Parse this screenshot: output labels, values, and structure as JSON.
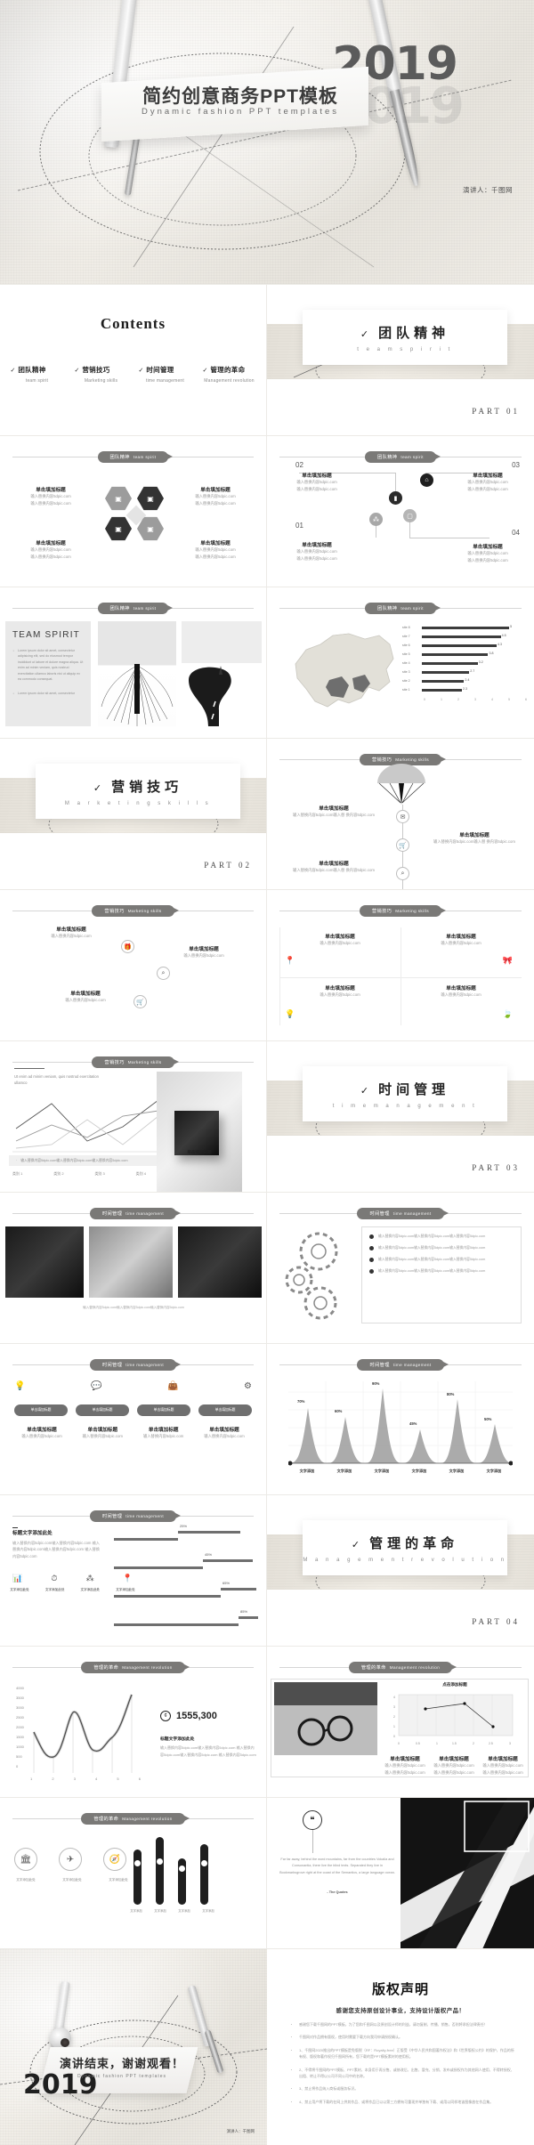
{
  "cover": {
    "year": "2019",
    "ghost": "2019",
    "title": "简约创意商务PPT模板",
    "subtitle": "Dynamic  fashion  PPT  templates",
    "speaker": "演讲人：千图网"
  },
  "contents": {
    "title": "Contents",
    "items": [
      {
        "tick": "✓",
        "cn": "团队精神",
        "en": "team spirit"
      },
      {
        "tick": "✓",
        "cn": "营销技巧",
        "en": "Marketing skills"
      },
      {
        "tick": "✓",
        "cn": "时间管理",
        "en": "time management"
      },
      {
        "tick": "✓",
        "cn": "管理的革命",
        "en": "Management revolution"
      }
    ]
  },
  "sections": [
    {
      "tick": "✓",
      "cn": "团队精神",
      "en": "t e a m   s p i r i t",
      "part": "PART  01"
    },
    {
      "tick": "✓",
      "cn": "营销技巧",
      "en": "M a r k e t i n g   s k i l l s",
      "part": "PART  02"
    },
    {
      "tick": "✓",
      "cn": "时间管理",
      "en": "t i m e   m a n a g e m e n t",
      "part": "PART  03"
    },
    {
      "tick": "✓",
      "cn": "管理的革命",
      "en": "M a n a g e m e n t   r e v o l u t i o n",
      "part": "PART  04"
    }
  ],
  "badges": {
    "team": {
      "cn": "团队精神",
      "en": "team spirit"
    },
    "mkt": {
      "cn": "营销技巧",
      "en": "Marketing skills"
    },
    "time": {
      "cn": "时间管理",
      "en": "time management"
    },
    "mgmt": {
      "cn": "管理的革命",
      "en": "Management revolution"
    }
  },
  "placeholder": {
    "title": "单击填加标题",
    "body1": "输入替换内容5dpic.com",
    "body2": "输入替换内容5dpic.com",
    "body_long": "输入替换内容5dpic.com输入替换内容5dpic.com",
    "title_here": "标题文字添加此处",
    "click_add": "点击添加标题",
    "text_add": "文字添加",
    "text_add2": "文字添加此处"
  },
  "slide_hex": {
    "blocks": [
      {
        "title": "单击填加标题",
        "b1": "输入替换内容5dpic.com",
        "b2": "输入替换内容5dpic.com"
      },
      {
        "title": "单击填加标题",
        "b1": "输入替换内容5dpic.com",
        "b2": "输入替换内容5dpic.com"
      },
      {
        "title": "单击填加标题",
        "b1": "输入替换内容5dpic.com",
        "b2": "输入替换内容5dpic.com"
      },
      {
        "title": "单击填加标题",
        "b1": "输入替换内容5dpic.com",
        "b2": "输入替换内容5dpic.com"
      }
    ]
  },
  "slide_timeline": {
    "nums": [
      "01",
      "02",
      "03",
      "04"
    ],
    "blocks": [
      {
        "title": "单击填加标题",
        "b1": "输入替换内容5dpic.com",
        "b2": "输入替换内容5dpic.com"
      },
      {
        "title": "单击填加标题",
        "b1": "输入替换内容5dpic.com",
        "b2": "输入替换内容5dpic.com"
      },
      {
        "title": "单击填加标题",
        "b1": "输入替换内容5dpic.com",
        "b2": "输入替换内容5dpic.com"
      },
      {
        "title": "单击填加标题",
        "b1": "输入替换内容5dpic.com",
        "b2": "输入替换内容5dpic.com"
      }
    ]
  },
  "team_spirit_panel": {
    "heading": "TEAM  SPIRIT",
    "items": [
      "Lorem ipsum dolor sit amet, consectetur adipisicing elit, sed do eiusmod tempor incididunt ut labore et dolore magna aliqua. Ut enim ad minim veniam, quis nostrud exercitation ullamco laboris nisi ut aliquip ex ea commodo consequat.",
      "Lorem ipsum dolor sit amet, consectetur"
    ]
  },
  "chart_data": [
    {
      "type": "bar",
      "title": "",
      "orientation": "horizontal",
      "categories": [
        "site 1",
        "site 2",
        "site 3",
        "site 4",
        "site 5",
        "site 6",
        "site 7",
        "site 8"
      ],
      "values": [
        2.3,
        2.4,
        2.7,
        3.2,
        3.8,
        4.3,
        4.5,
        5.0
      ],
      "xlabel": "",
      "ylabel": "",
      "xlim": [
        0,
        6
      ],
      "xticks": [
        "0",
        "1",
        "2",
        "3",
        "4",
        "5",
        "6"
      ],
      "grid": false,
      "legend": "none"
    },
    {
      "type": "area",
      "title": "",
      "categories": [
        "文字添加",
        "文字添加",
        "文字添加",
        "文字添加",
        "文字添加",
        "文字添加"
      ],
      "values": [
        70,
        60,
        90,
        45,
        80,
        50
      ],
      "labels": [
        "70%",
        "60%",
        "90%",
        "45%",
        "80%",
        "50%"
      ],
      "ylim": [
        0,
        100
      ],
      "grid": true,
      "legend": "none"
    },
    {
      "type": "line",
      "title": "",
      "x": [
        "1",
        "2",
        "3",
        "4",
        "5",
        "6"
      ],
      "values": [
        1950,
        900,
        2780,
        1100,
        1750,
        3500
      ],
      "ylim": [
        0,
        4000
      ],
      "yticks": [
        "0",
        "500",
        "1000",
        "1500",
        "2000",
        "2500",
        "3000",
        "3500",
        "4000"
      ],
      "callout_value": "1555,300",
      "callout_title": "标题文字添加此处",
      "callout_body": "输入替换内容5dpic.com输入替换内容5dpic.com 输入替换内容5dpic.com输入替换内容5dpic.com 输入替换内容5dpic.com",
      "grid": false,
      "legend": "none"
    },
    {
      "type": "line",
      "title": "点击添加标题",
      "x": [
        0.7,
        1.8,
        2.6
      ],
      "values": [
        2.6,
        3.1,
        0.9
      ],
      "xlim": [
        0,
        3
      ],
      "ylim": [
        0,
        4
      ],
      "xticks": [
        "0",
        "0.5",
        "1",
        "1.5",
        "2",
        "2.5",
        "3"
      ],
      "yticks": [
        "0",
        "1",
        "2",
        "3",
        "4"
      ],
      "grid": true,
      "legend": "none"
    },
    {
      "type": "bar",
      "title": "标题文字添加此处",
      "orientation": "horizontal",
      "categories": [
        "文字添加此处",
        "文字添加此处",
        "文字添加此处",
        "文字添加此处"
      ],
      "values": [
        25,
        45,
        65,
        85
      ],
      "labels": [
        "25%",
        "45%",
        "65%",
        "85%"
      ],
      "xlim": [
        0,
        100
      ],
      "grid": false,
      "legend": "none"
    }
  ],
  "slide_mkt_icons": {
    "blocks": [
      {
        "title": "单击填加标题",
        "body": "输入替换内容5dpic.com输入替 换内容5dpic.com"
      },
      {
        "title": "单击填加标题",
        "body": "输入替换内容5dpic.com输入替 换内容5dpic.com"
      },
      {
        "title": "单击填加标题",
        "body": "输入替换内容5dpic.com输入替 换内容5dpic.com"
      },
      {
        "title": "单击填加标题",
        "body": "输入替换内容5dpic.com输入替 换内容5dpic.com"
      }
    ]
  },
  "slide_mkt_grid": {
    "blocks": [
      {
        "title": "单击填加标题",
        "body": "输入替换内容5dpic.com"
      },
      {
        "title": "单击填加标题",
        "body": "输入替换内容5dpic.com"
      },
      {
        "title": "单击填加标题",
        "body": "输入替换内容5dpic.com"
      },
      {
        "title": "单击填加标题",
        "body": "输入替换内容5dpic.com"
      }
    ]
  },
  "slide_mkt_lines": {
    "lead": "Ut enim ad minim veniam, quis nostrud exercitation ullamco",
    "legend": "输入替换内容5dpic.com输入替换内容5dpic.com输入替换内容5dpic.com",
    "axis": [
      "类别 1",
      "类别 2",
      "类别 3",
      "类别 4"
    ],
    "caption": "单击填加标题"
  },
  "slide_gears": {
    "rows": [
      "输入替换内容5dpic.com输入替换内容5dpic.com输入替换内容5dpic.com",
      "输入替换内容5dpic.com输入替换内容5dpic.com输入替换内容5dpic.com",
      "输入替换内容5dpic.com输入替换内容5dpic.com输入替换内容5dpic.com",
      "输入替换内容5dpic.com输入替换内容5dpic.com输入替换内容5dpic.com"
    ]
  },
  "slide_pills": {
    "pills": [
      "单击填加标题",
      "单击填加标题",
      "单击填加标题",
      "单击填加标题"
    ],
    "blocks": [
      {
        "title": "单击填加标题",
        "body": "输入替换内容5dpic.com"
      },
      {
        "title": "单击填加标题",
        "body": "输入替换内容5dpic.com"
      },
      {
        "title": "单击填加标题",
        "body": "输入替换内容5dpic.com"
      },
      {
        "title": "单击填加标题",
        "body": "输入替换内容5dpic.com"
      }
    ]
  },
  "slide_process": {
    "title": "标题文字添加此处",
    "body": "输入替换内容5dpic.com输入替换内容5dpic.com 输入替换内容5dpic.com输入替换内容5dpic.com 输入替换内容5dpic.com",
    "icons": [
      {
        "glyph": "📊",
        "label": "文字添加\n此处"
      },
      {
        "glyph": "⏱",
        "label": "文字添加\n此处"
      },
      {
        "glyph": "⚙",
        "label": "文字添加\n此处"
      },
      {
        "glyph": "📍",
        "label": "文字添加\n此处"
      }
    ],
    "icon_labels": [
      "文字添加此处",
      "文字添加此处",
      "文字添加此处",
      "文字添加此处"
    ]
  },
  "slide_photo_chart": {
    "blocks": [
      {
        "title": "单击填加标题",
        "b1": "输入替换内容5dpic.com",
        "b2": "输入替换内容5dpic.com"
      },
      {
        "title": "单击填加标题",
        "b1": "输入替换内容5dpic.com",
        "b2": "输入替换内容5dpic.com"
      },
      {
        "title": "单击填加标题",
        "b1": "输入替换内容5dpic.com",
        "b2": "输入替换内容5dpic.com"
      }
    ]
  },
  "slide_quote": {
    "quote": "Far far away, behind the word mountains, far from the countries Vokalia and Consonantia, there live the blind texts. Separated they live in Bookmarksgrove right at the coast of the Semantics, a large language ocean.",
    "attrib": "- The Quotes",
    "icons": [
      "🏛",
      "✈",
      "⚓",
      "🗂"
    ],
    "icon_labels": [
      "文字添加此处",
      "文字添加此处",
      "文字添加此处"
    ],
    "bar_labels": [
      "文字添加",
      "文字添加",
      "文字添加",
      "文字添加"
    ]
  },
  "copyright": {
    "title": "版权声明",
    "subtitle": "感谢您支持原创设计事业，支持设计版权产品！",
    "items": [
      "感谢您下载千图网的PPT模板，为了您和千图网以及原创设计师的利益，请勿复制、传播、销售，否则将承担法律责任！",
      "千图网对作品拥有版权，使用时需要下载方向我司申请授权确认。",
      "1、千图网2020推出的PPT模板是免版税（RF：Royalty-free）正版受《中华人民共和国著作权法》和《世界版权公约》的保护，作品的所有权、版权和著作权归千图网所有，您下载的是PPT模板素材的使用权。",
      "2、不得将千图网的PPT模板、PPT素材，本身用于再分售、或修改后、出售、冒充、分销、发布或授权作为其他网人使用、不得转授权、出租、转让不得以公司不同公司中的名称。",
      "3、禁止将作品纳入商标或服务标识。",
      "4、禁止用户将下载的在网上供其作品、或将作品已以以第三方拥有可重现并单独有下载、或用以同样地该图像放在作品集。"
    ]
  },
  "thanks": {
    "year": "2019",
    "title": "演讲结束，谢谢观看！",
    "subtitle": "Dynamic  fashion  PPT  templates",
    "speaker": "演讲人：千图网"
  }
}
